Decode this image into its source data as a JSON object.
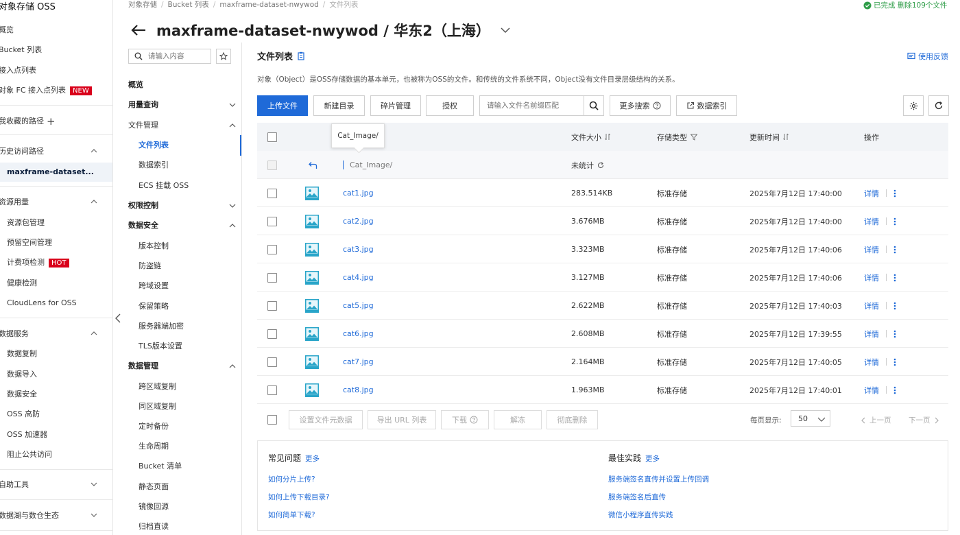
{
  "leftnav": {
    "brand": "对象存储 OSS",
    "items": [
      {
        "label": "概览"
      },
      {
        "label": "Bucket 列表"
      },
      {
        "label": "接入点列表"
      },
      {
        "label": "对象 FC 接入点列表",
        "badge": "NEW"
      },
      {
        "label": "我收藏的路径"
      },
      {
        "label": "历史访问路径"
      },
      {
        "label": "maxframe-dataset..."
      },
      {
        "label": "资源用量"
      },
      {
        "label": "资源包管理"
      },
      {
        "label": "预留空间管理"
      },
      {
        "label": "计费项检测",
        "badge": "HOT"
      },
      {
        "label": "健康检测"
      },
      {
        "label": "CloudLens for OSS"
      },
      {
        "label": "数据服务"
      },
      {
        "label": "数据复制"
      },
      {
        "label": "数据导入"
      },
      {
        "label": "数据安全"
      },
      {
        "label": "OSS 高防"
      },
      {
        "label": "OSS 加速器"
      },
      {
        "label": "阻止公共访问"
      },
      {
        "label": "自助工具"
      },
      {
        "label": "数据湖与数仓生态"
      }
    ]
  },
  "breadcrumb": [
    "对象存储",
    "Bucket 列表",
    "maxframe-dataset-nwywod",
    "文件列表"
  ],
  "top_note": "已完成 删除109个文件",
  "page_title": "maxframe-dataset-nwywod / 华东2（上海）",
  "secnav": {
    "search_placeholder": "请输入内容",
    "items": [
      {
        "label": "概览"
      },
      {
        "label": "用量查询"
      },
      {
        "label": "文件管理"
      },
      {
        "label": "文件列表"
      },
      {
        "label": "数据索引"
      },
      {
        "label": "ECS 挂载 OSS"
      },
      {
        "label": "权限控制"
      },
      {
        "label": "数据安全"
      },
      {
        "label": "版本控制"
      },
      {
        "label": "防盗链"
      },
      {
        "label": "跨域设置"
      },
      {
        "label": "保留策略"
      },
      {
        "label": "服务器端加密"
      },
      {
        "label": "TLS版本设置"
      },
      {
        "label": "数据管理"
      },
      {
        "label": "跨区域复制"
      },
      {
        "label": "同区域复制"
      },
      {
        "label": "定时备份"
      },
      {
        "label": "生命周期"
      },
      {
        "label": "Bucket 清单"
      },
      {
        "label": "静态页面"
      },
      {
        "label": "镜像回源"
      },
      {
        "label": "归档直读"
      }
    ]
  },
  "main": {
    "heading": "文件列表",
    "feedback": "使用反馈",
    "description": "对象（Object）是OSS存储数据的基本单元，也被称为OSS的文件。和传统的文件系统不同，Object没有文件目录层级结构的关系。",
    "toolbar": {
      "upload": "上传文件",
      "new_dir": "新建目录",
      "fragments": "碎片管理",
      "authorize": "授权",
      "search_placeholder": "请输入文件名前缀匹配",
      "more_search": "更多搜索",
      "data_index": "数据索引"
    },
    "table": {
      "headers": {
        "size": "文件大小",
        "storage": "存储类型",
        "updated": "更新时间",
        "actions": "操作"
      },
      "tooltip": "Cat_Image/",
      "parent": {
        "path": "Cat_Image/",
        "size": "未统计"
      },
      "rows": [
        {
          "name": "cat1.jpg",
          "size": "283.514KB",
          "storage": "标准存储",
          "updated": "2025年7月12日 17:40:00",
          "action": "详情"
        },
        {
          "name": "cat2.jpg",
          "size": "3.676MB",
          "storage": "标准存储",
          "updated": "2025年7月12日 17:40:00",
          "action": "详情"
        },
        {
          "name": "cat3.jpg",
          "size": "3.323MB",
          "storage": "标准存储",
          "updated": "2025年7月12日 17:40:06",
          "action": "详情"
        },
        {
          "name": "cat4.jpg",
          "size": "3.127MB",
          "storage": "标准存储",
          "updated": "2025年7月12日 17:40:06",
          "action": "详情"
        },
        {
          "name": "cat5.jpg",
          "size": "2.622MB",
          "storage": "标准存储",
          "updated": "2025年7月12日 17:40:03",
          "action": "详情"
        },
        {
          "name": "cat6.jpg",
          "size": "2.608MB",
          "storage": "标准存储",
          "updated": "2025年7月12日 17:39:55",
          "action": "详情"
        },
        {
          "name": "cat7.jpg",
          "size": "2.164MB",
          "storage": "标准存储",
          "updated": "2025年7月12日 17:40:05",
          "action": "详情"
        },
        {
          "name": "cat8.jpg",
          "size": "1.963MB",
          "storage": "标准存储",
          "updated": "2025年7月12日 17:40:01",
          "action": "详情"
        }
      ]
    },
    "bulk": {
      "set_meta": "设置文件元数据",
      "export_url": "导出 URL 列表",
      "download": "下载",
      "unfreeze": "解冻",
      "delete": "彻底删除",
      "per_page_label": "每页显示:",
      "per_page": "50",
      "prev": "上一页",
      "next": "下一页"
    },
    "faq": {
      "title": "常见问题",
      "more": "更多",
      "links": [
        "如何分片上传?",
        "如何上传下载目录?",
        "如何简单下载?"
      ]
    },
    "best": {
      "title": "最佳实践",
      "more": "更多",
      "links": [
        "服务端签名直传并设置上传回调",
        "服务端签名后直传",
        "微信小程序直传实践"
      ]
    }
  },
  "colors": {
    "accent": "#1f6ad8",
    "badge": "#d9001b",
    "success": "#2e9d48",
    "image_icon": "#29a5c9"
  }
}
